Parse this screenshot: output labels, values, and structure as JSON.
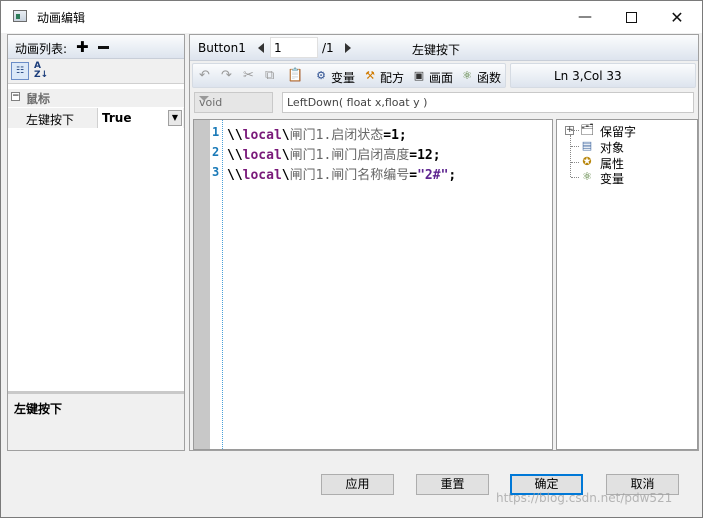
{
  "window": {
    "title": "动画编辑"
  },
  "left": {
    "list_label": "动画列表:",
    "category": {
      "toggle": "⊟",
      "name": "鼠标"
    },
    "property": {
      "name": "左键按下",
      "value": "True"
    },
    "description": "左键按下"
  },
  "nav": {
    "button_name": "Button1",
    "page": "1",
    "page_total": "/1",
    "event_title": "左键按下"
  },
  "toolbar": {
    "variable": "变量",
    "recipe": "配方",
    "screen": "画面",
    "function": "函数",
    "cursor_pos": "Ln 3,Col 33"
  },
  "signature": {
    "return_type": "void",
    "text": "LeftDown( float x,float y )"
  },
  "code": {
    "line_numbers": [
      "1",
      "2",
      "3"
    ],
    "lines": [
      {
        "bs": "\\\\",
        "kw": "local",
        "sep": "\\",
        "id": "闸门1.启闭状态",
        "op": "=1;"
      },
      {
        "bs": "\\\\",
        "kw": "local",
        "sep": "\\",
        "id": "闸门1.闸门启闭高度",
        "op": "=12;"
      },
      {
        "bs": "\\\\",
        "kw": "local",
        "sep": "\\",
        "id": "闸门1.闸门名称编号",
        "op": "=",
        "str": "\"2#\"",
        "end": ";"
      }
    ]
  },
  "tree": {
    "expander": "+",
    "items": [
      "保留字",
      "对象",
      "属性",
      "变量"
    ]
  },
  "buttons": {
    "apply": "应用",
    "reset": "重置",
    "ok": "确定",
    "cancel": "取消"
  },
  "watermark": "https://blog.csdn.net/pdw521"
}
